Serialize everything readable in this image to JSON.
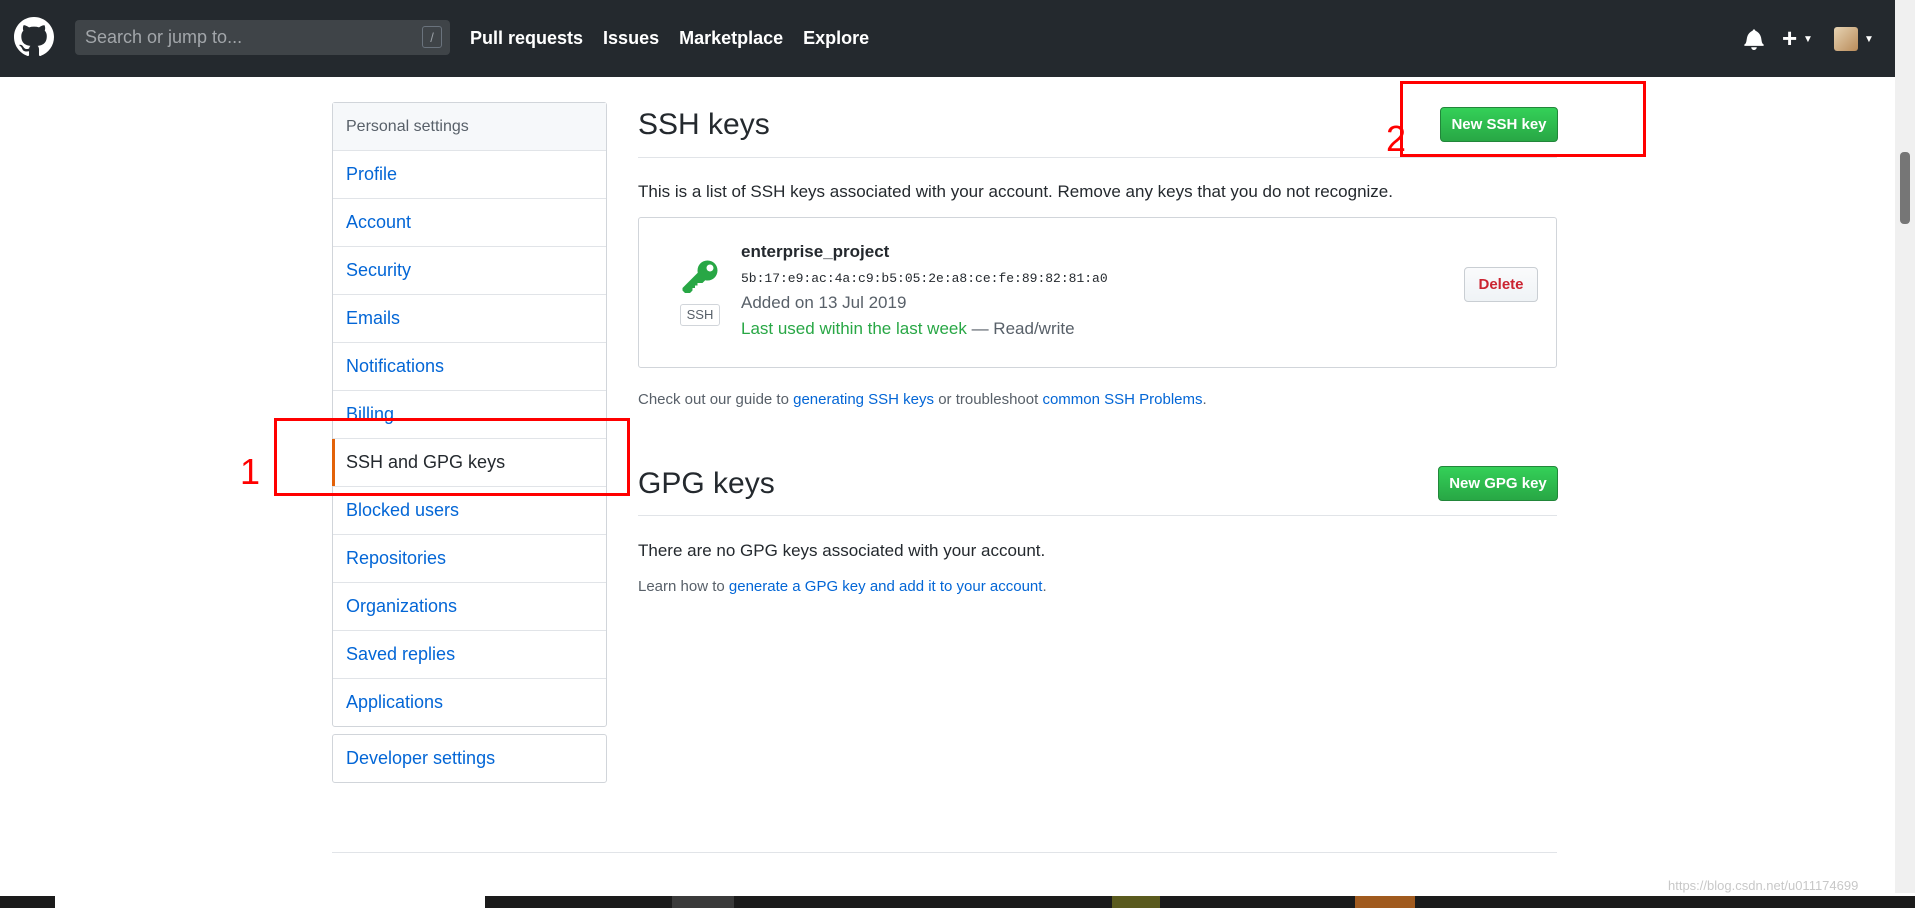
{
  "header": {
    "search_placeholder": "Search or jump to...",
    "search_shortcut": "/",
    "nav": [
      "Pull requests",
      "Issues",
      "Marketplace",
      "Explore"
    ],
    "plus_label": "+"
  },
  "sidebar": {
    "heading": "Personal settings",
    "items": [
      {
        "label": "Profile"
      },
      {
        "label": "Account"
      },
      {
        "label": "Security"
      },
      {
        "label": "Emails"
      },
      {
        "label": "Notifications"
      },
      {
        "label": "Billing"
      },
      {
        "label": "SSH and GPG keys"
      },
      {
        "label": "Blocked users"
      },
      {
        "label": "Repositories"
      },
      {
        "label": "Organizations"
      },
      {
        "label": "Saved replies"
      },
      {
        "label": "Applications"
      }
    ],
    "selected_index": 6,
    "developer_settings": "Developer settings"
  },
  "ssh": {
    "title": "SSH keys",
    "new_button": "New SSH key",
    "description": "This is a list of SSH keys associated with your account. Remove any keys that you do not recognize.",
    "key": {
      "label": "SSH",
      "title": "enterprise_project",
      "fingerprint": "5b:17:e9:ac:4a:c9:b5:05:2e:a8:ce:fe:89:82:81:a0",
      "added": "Added on 13 Jul 2019",
      "last_used": "Last used within the last week",
      "access": " — Read/write",
      "delete_button": "Delete"
    },
    "guide_prefix": "Check out our guide to ",
    "guide_link": "generating SSH keys",
    "guide_middle": " or troubleshoot ",
    "guide_link2": "common SSH Problems",
    "guide_suffix": "."
  },
  "gpg": {
    "title": "GPG keys",
    "new_button": "New GPG key",
    "empty_text": "There are no GPG keys associated with your account.",
    "learn_prefix": "Learn how to ",
    "learn_link": "generate a GPG key and add it to your account",
    "learn_suffix": "."
  },
  "annotations": {
    "marker_1": "1",
    "marker_2": "2",
    "color": "#ff0000"
  },
  "watermark": "https://blog.csdn.net/u011174699",
  "colors": {
    "header_bg": "#24292e",
    "link": "#0366d6",
    "green": "#28a745",
    "selected_accent": "#e36209"
  }
}
